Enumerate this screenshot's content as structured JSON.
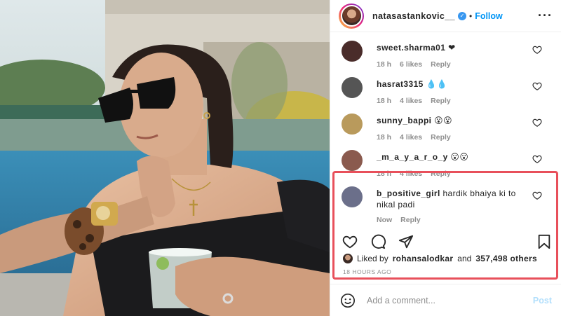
{
  "post": {
    "header": {
      "username": "natasastankovic__",
      "follow_label": "Follow",
      "separator": "•",
      "more_icon": "more-horizontal-icon"
    },
    "comments": [
      {
        "username": "sweet.sharma01",
        "text": "❤",
        "time": "18 h",
        "likes": "6 likes",
        "reply": "Reply",
        "avatar_color": "#4a2c2a"
      },
      {
        "username": "hasrat3315",
        "text": "💧💧",
        "time": "18 h",
        "likes": "4 likes",
        "reply": "Reply",
        "avatar_color": "#555555"
      },
      {
        "username": "sunny_bappi",
        "text": "😮😮",
        "time": "18 h",
        "likes": "4 likes",
        "reply": "Reply",
        "avatar_color": "#b99a5c"
      },
      {
        "username": "_m_a_y_a_r_o_y",
        "text": "😮😮",
        "time": "18 h",
        "likes": "4 likes",
        "reply": "Reply",
        "avatar_color": "#8a5a4e"
      },
      {
        "username": "b_positive_girl",
        "text": "hardik bhaiya ki to nikal padi",
        "time": "Now",
        "likes": "",
        "reply": "Reply",
        "avatar_color": "#6b6f8a"
      }
    ],
    "likes": {
      "prefix": "Liked by",
      "user": "rohansalodkar",
      "mid": "and",
      "count": "357,498 others"
    },
    "timestamp": "18 HOURS AGO",
    "add_comment": {
      "placeholder": "Add a comment...",
      "post_label": "Post"
    },
    "colors": {
      "accent": "#0095f6",
      "highlight": "#e8505b",
      "muted": "#8e8e8e"
    }
  }
}
